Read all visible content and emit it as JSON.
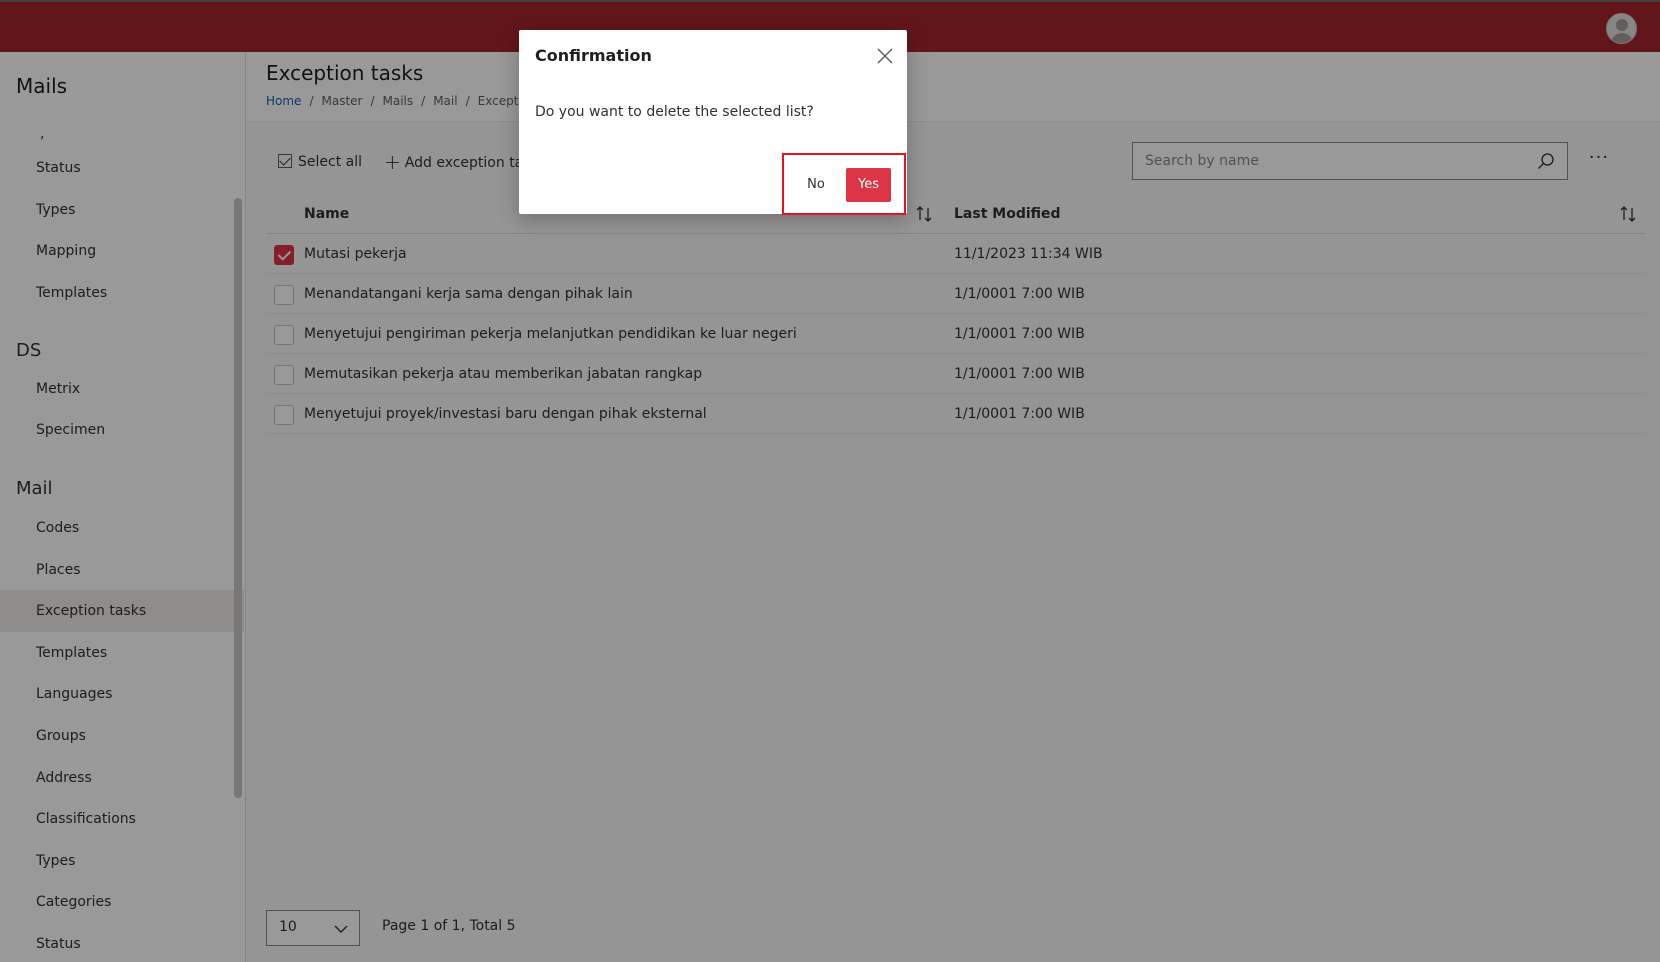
{
  "sidebar": {
    "title": "Mails",
    "stray_mark": ",",
    "groups": [
      {
        "label": "DS"
      },
      {
        "label": "Mail"
      }
    ],
    "items": [
      {
        "label": "Status"
      },
      {
        "label": "Types"
      },
      {
        "label": "Mapping"
      },
      {
        "label": "Templates"
      },
      {
        "label": "Metrix"
      },
      {
        "label": "Specimen"
      },
      {
        "label": "Codes"
      },
      {
        "label": "Places"
      },
      {
        "label": "Exception tasks"
      },
      {
        "label": "Templates"
      },
      {
        "label": "Languages"
      },
      {
        "label": "Groups"
      },
      {
        "label": "Address"
      },
      {
        "label": "Classifications"
      },
      {
        "label": "Types"
      },
      {
        "label": "Categories"
      },
      {
        "label": "Status"
      }
    ],
    "active_item": "Exception tasks"
  },
  "header": {
    "title": "Exception tasks",
    "breadcrumb": [
      "Home",
      "Master",
      "Mails",
      "Mail",
      "Exceptio"
    ]
  },
  "toolbar": {
    "select_all_label": "Select all",
    "add_label": "Add exception task",
    "more_label": "···"
  },
  "search": {
    "placeholder": "Search by name",
    "value": ""
  },
  "table": {
    "columns": [
      "Name",
      "Last Modified"
    ],
    "rows": [
      {
        "name": "Mutasi pekerja",
        "modified": "11/1/2023 11:34 WIB",
        "checked": true
      },
      {
        "name": "Menandatangani kerja sama dengan pihak lain",
        "modified": "1/1/0001 7:00 WIB",
        "checked": false
      },
      {
        "name": "Menyetujui pengiriman pekerja melanjutkan pendidikan ke luar negeri",
        "modified": "1/1/0001 7:00 WIB",
        "checked": false
      },
      {
        "name": "Memutasikan pekerja atau memberikan jabatan rangkap",
        "modified": "1/1/0001 7:00 WIB",
        "checked": false
      },
      {
        "name": "Menyetujui proyek/investasi baru dengan pihak eksternal",
        "modified": "1/1/0001 7:00 WIB",
        "checked": false
      }
    ]
  },
  "pagination": {
    "page_size": "10",
    "info": "Page 1 of 1, Total 5"
  },
  "dialog": {
    "title": "Confirmation",
    "message": "Do you want to delete the selected list?",
    "no_label": "No",
    "yes_label": "Yes"
  },
  "colors": {
    "topbar": "#a4262c",
    "accent": "#dc3545",
    "highlight": "#e81123",
    "link": "#0f5fa8"
  },
  "icons": {
    "avatar": "user-avatar-icon",
    "search": "search-icon",
    "sort": "sort-icon",
    "close": "close-icon",
    "chevron": "chevron-down-icon",
    "check": "check-icon",
    "plus": "plus-icon"
  }
}
